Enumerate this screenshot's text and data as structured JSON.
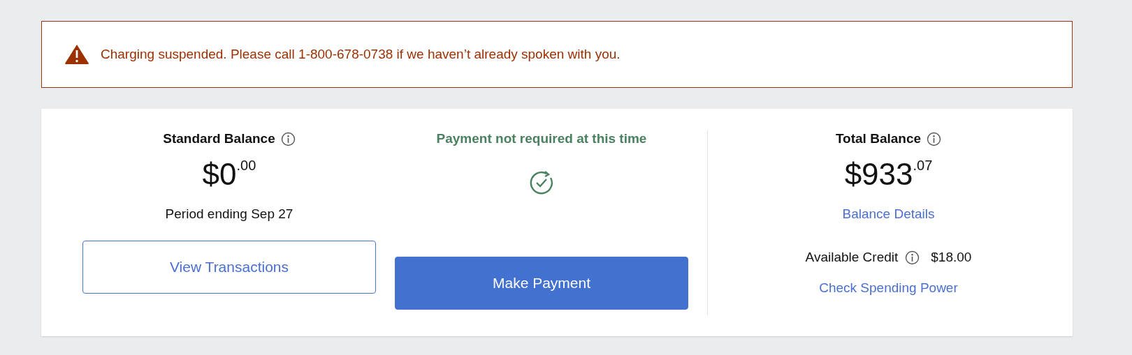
{
  "alert": {
    "message": "Charging suspended. Please call 1-800-678-0738 if we haven’t already spoken with you."
  },
  "standard_balance": {
    "title": "Standard Balance",
    "amount": "$0",
    "cents": ".00",
    "period": "Period ending Sep 27",
    "button": "View Transactions"
  },
  "payment_status": {
    "message": "Payment not required at this time",
    "button": "Make Payment"
  },
  "total_balance": {
    "title": "Total Balance",
    "amount": "$933",
    "cents": ".07",
    "details_link": "Balance Details",
    "available_credit": {
      "label": "Available Credit",
      "value": "$18.00"
    },
    "spending_link": "Check Spending Power"
  }
}
